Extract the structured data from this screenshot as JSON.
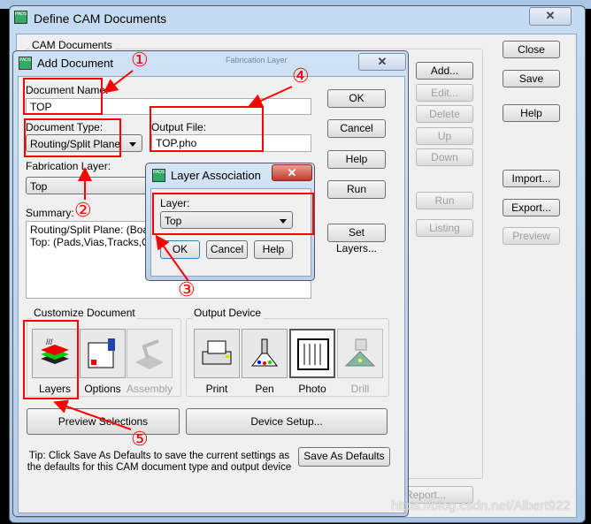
{
  "main_window": {
    "title": "Define CAM Documents",
    "group_label": "CAM Documents",
    "hidden_column": "Fabrication Layer",
    "list_buttons": [
      {
        "label": "Add...",
        "enabled": true
      },
      {
        "label": "Edit...",
        "enabled": false
      },
      {
        "label": "Delete",
        "enabled": false
      },
      {
        "label": "Up",
        "enabled": false
      },
      {
        "label": "Down",
        "enabled": false
      },
      {
        "label": "Run",
        "enabled": false
      },
      {
        "label": "Listing",
        "enabled": false
      }
    ],
    "report_label": "Report...",
    "side_buttons": [
      {
        "label": "Close",
        "enabled": true
      },
      {
        "label": "Save",
        "enabled": true
      },
      {
        "label": "Help",
        "enabled": true
      },
      {
        "label": "Import...",
        "enabled": true
      },
      {
        "label": "Export...",
        "enabled": true
      },
      {
        "label": "Preview",
        "enabled": false
      }
    ]
  },
  "add_document": {
    "title": "Add Document",
    "doc_name_label": "Document Name:",
    "doc_name_value": "TOP",
    "doc_type_label": "Document Type:",
    "doc_type_value": "Routing/Split Plane",
    "output_file_label": "Output File:",
    "output_file_value": "TOP.pho",
    "fab_layer_label": "Fabrication Layer:",
    "fab_layer_value": "Top",
    "summary_label": "Summary:",
    "summary_lines": [
      "Routing/Split Plane: (Board)",
      "Top: (Pads,Vias,Tracks,Cop"
    ],
    "buttons": {
      "ok": "OK",
      "cancel": "Cancel",
      "help": "Help",
      "run": "Run",
      "set_layers": "Set Layers..."
    },
    "customize_label": "Customize Document",
    "customize_items": [
      {
        "label": "Layers",
        "enabled": true
      },
      {
        "label": "Options",
        "enabled": true
      },
      {
        "label": "Assembly",
        "enabled": false
      }
    ],
    "output_label": "Output Device",
    "output_items": [
      {
        "label": "Print",
        "enabled": true
      },
      {
        "label": "Pen",
        "enabled": true
      },
      {
        "label": "Photo",
        "enabled": true,
        "selected": true
      },
      {
        "label": "Drill",
        "enabled": false
      }
    ],
    "preview_selections": "Preview Selections",
    "device_setup": "Device Setup...",
    "tip": "Tip: Click Save As Defaults to save the current settings as the defaults for this CAM document type and output device",
    "save_defaults": "Save As Defaults"
  },
  "layer_association": {
    "title": "Layer Association",
    "layer_label": "Layer:",
    "layer_value": "Top",
    "ok": "OK",
    "cancel": "Cancel",
    "help": "Help"
  },
  "annotations": {
    "color": "#ff0000",
    "markers": [
      "①",
      "②",
      "③",
      "④",
      "⑤"
    ]
  },
  "watermark": "https://blog.csdn.net/Albert922"
}
